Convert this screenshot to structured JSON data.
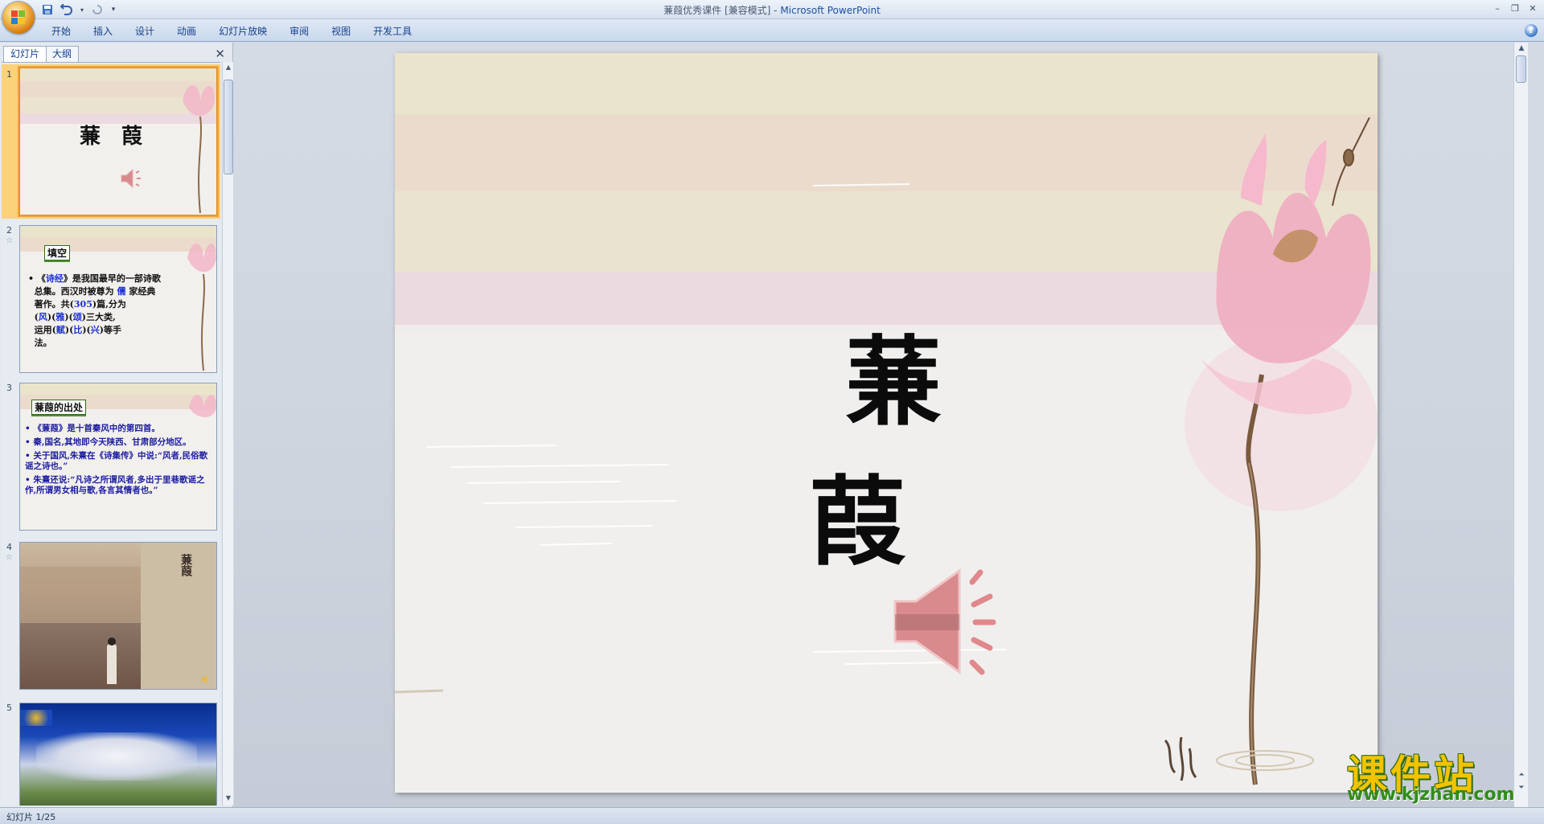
{
  "window": {
    "title_doc": "蒹葭优秀课件 [兼容模式] - ",
    "title_app": "Microsoft PowerPoint"
  },
  "ribbon": {
    "tabs": [
      "开始",
      "插入",
      "设计",
      "动画",
      "幻灯片放映",
      "审阅",
      "视图",
      "开发工具"
    ]
  },
  "left_pane": {
    "tabs": [
      "幻灯片",
      "大纲"
    ],
    "active_tab": "幻灯片"
  },
  "thumbnails": [
    {
      "num": "1",
      "title": "蒹　葭"
    },
    {
      "num": "2",
      "box": "填空",
      "lines": {
        "a1": "《",
        "a2": "诗经",
        "a3": "》是我国最早的一部诗歌",
        "b1": "总集。西汉时被尊为",
        "b2": "儒",
        "b3": "家经典",
        "c1": "著作。共(",
        "c2": "305",
        "c3": ")篇,分为",
        "d1": "(",
        "d2": "风",
        "d3": ")(",
        "d4": "雅",
        "d5": ")(",
        "d6": "颂",
        "d7": ")三大类,",
        "e1": "运用(",
        "e2": "赋",
        "e3": ")(",
        "e4": "比",
        "e5": ")(",
        "e6": "兴",
        "e7": ")等手",
        "f1": "法。"
      }
    },
    {
      "num": "3",
      "box": "蒹葭的出处",
      "items": [
        "《蒹葭》是十首秦风中的第四首。",
        "秦,国名,其地即今天陕西、甘肃部分地区。",
        "关于国风,朱熹在《诗集传》中说:“风者,民俗歌谣之诗也。”",
        "朱熹还说:“凡诗之所谓风者,多出于里巷歌谣之作,所谓男女相与歌,各言其情者也。”"
      ]
    },
    {
      "num": "4",
      "vert": "蒹葭"
    },
    {
      "num": "5"
    }
  ],
  "slide": {
    "title": "蒹　　葭"
  },
  "status": {
    "text": "幻灯片 1/25"
  },
  "watermark": {
    "cn": "课件站",
    "url": "www.kjzhan.com"
  },
  "colors": {
    "band1": "#ebe4cd",
    "band2": "#ebdbcd",
    "band3": "#eae3cf",
    "band4": "#ebdadf",
    "slide_bg": "#f0efed",
    "speaker": "#d98a8d",
    "lotus": "#f0a9c0"
  }
}
